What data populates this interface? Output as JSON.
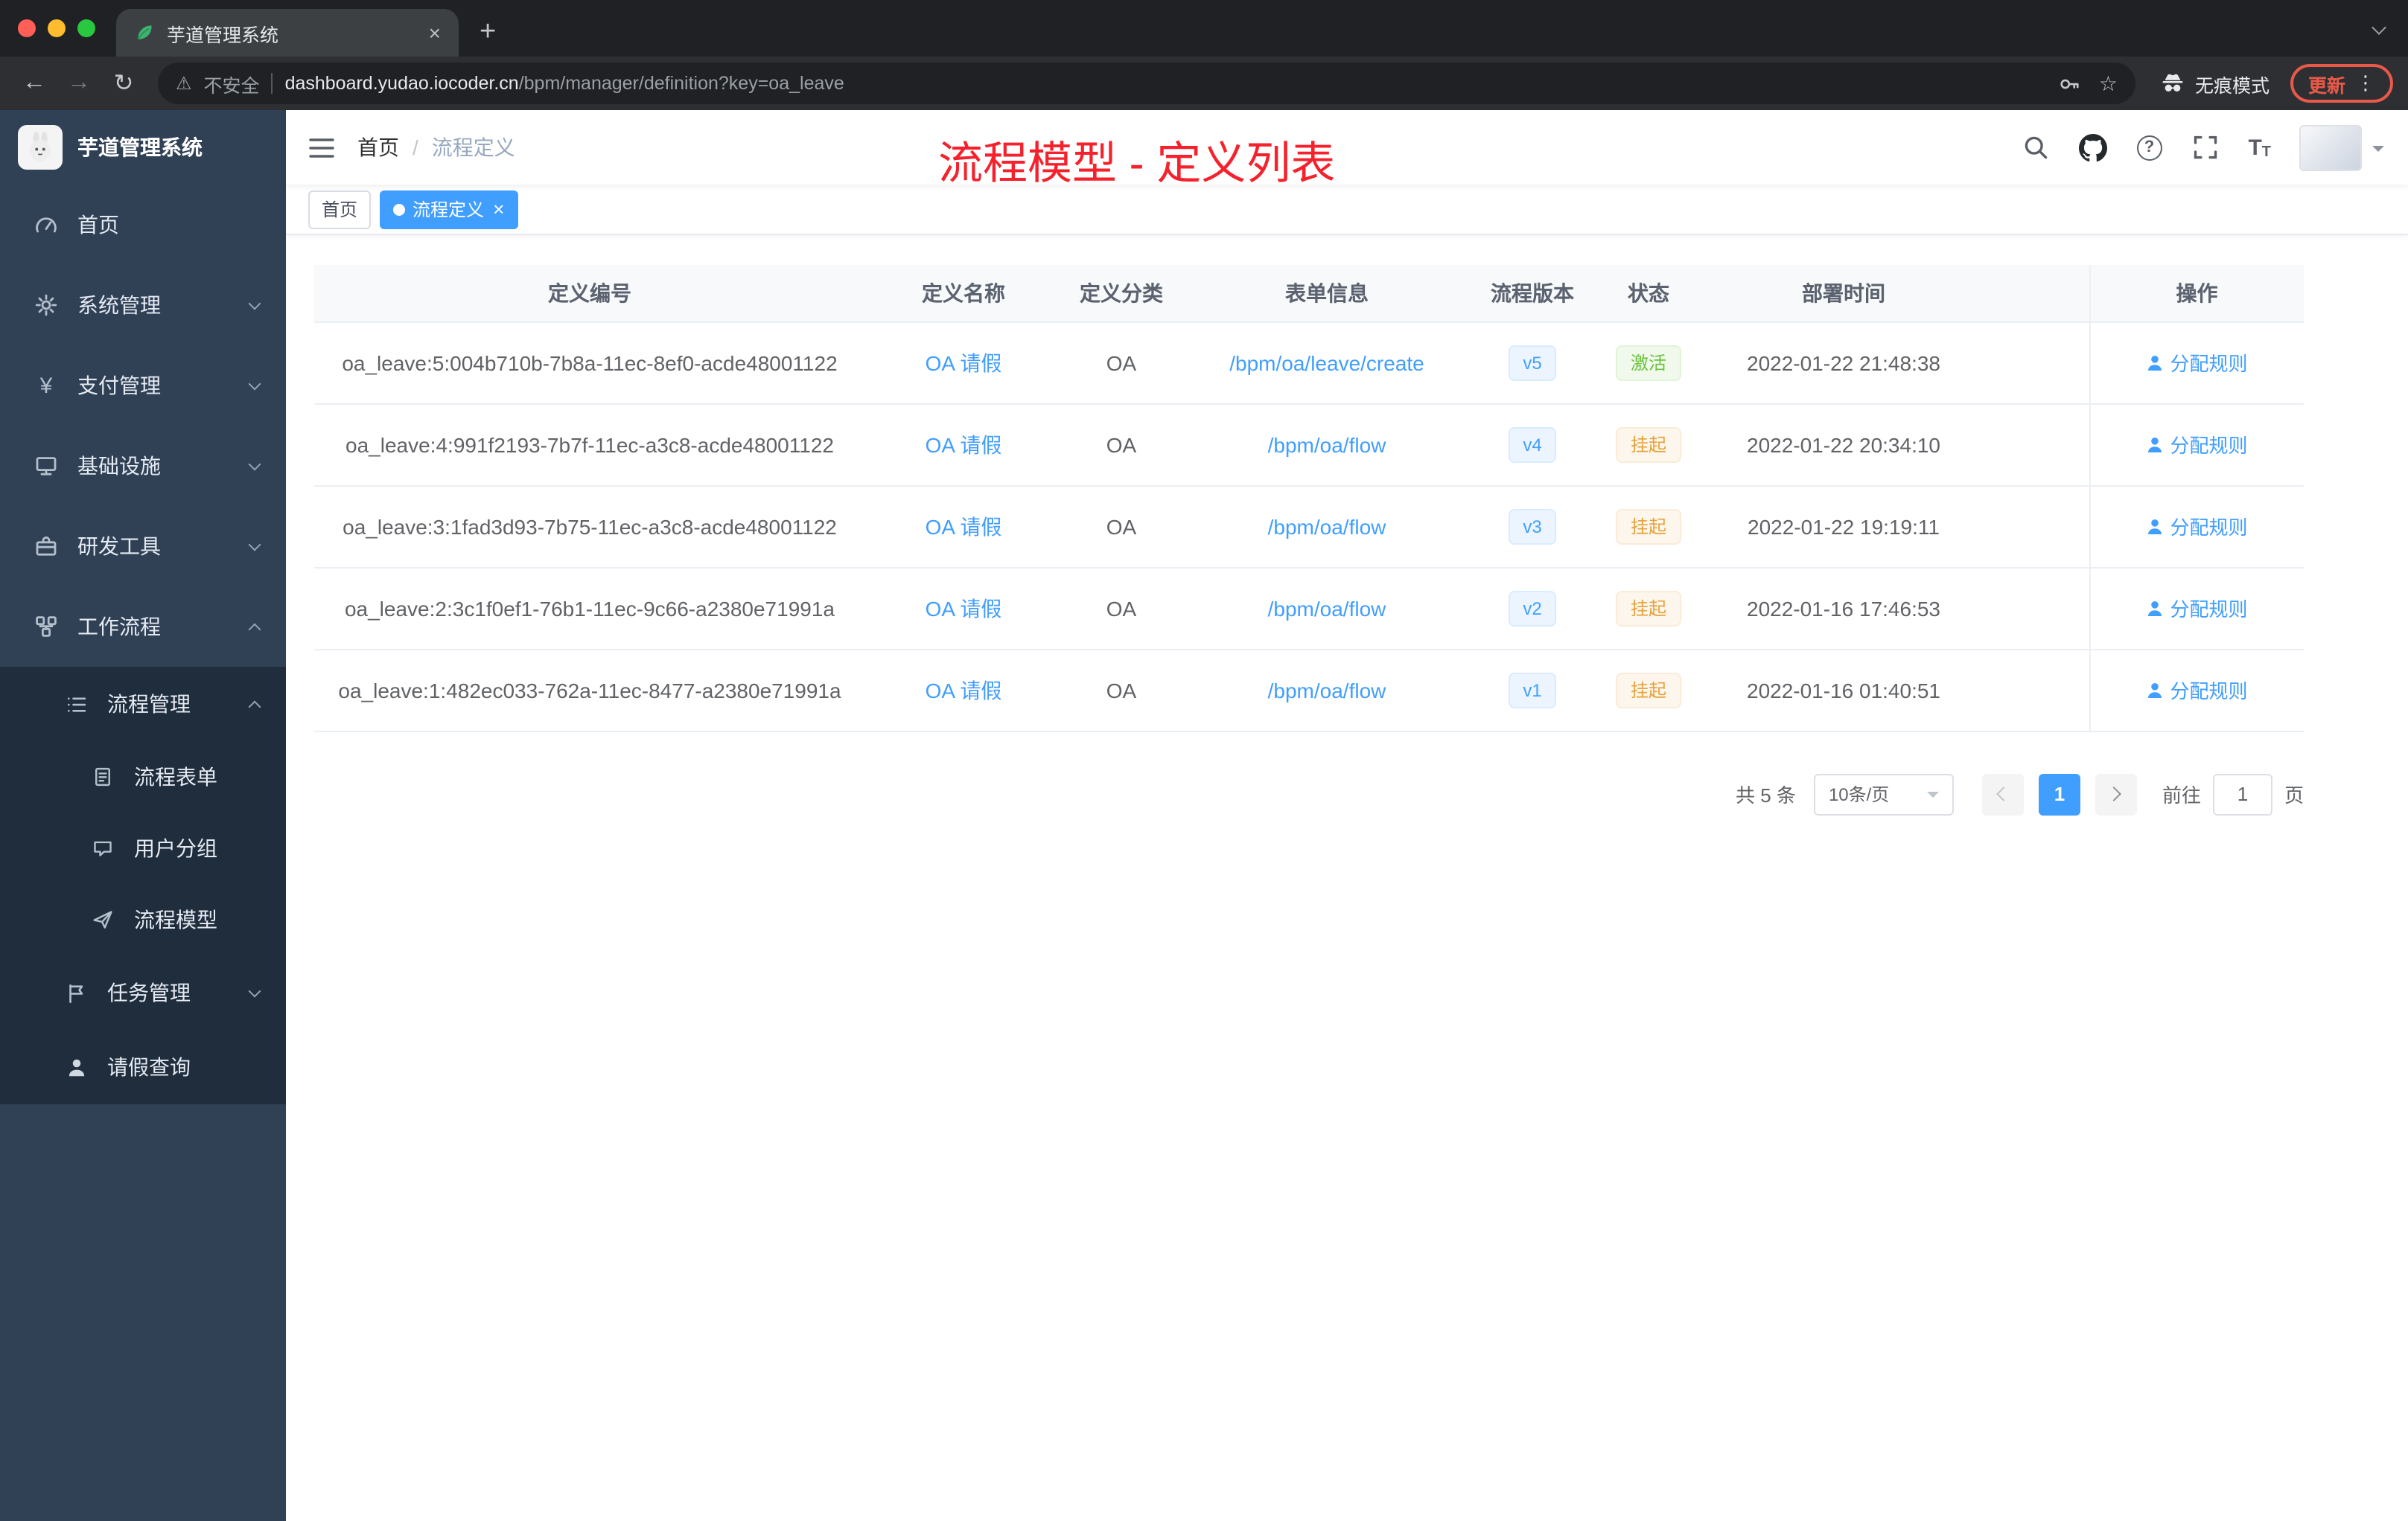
{
  "icons": {
    "back": "←",
    "forward": "→",
    "reload": "↻",
    "warning": "⚠",
    "star": "☆",
    "menu_dots": "⋮",
    "new_tab": "+",
    "close": "×",
    "yen": "¥",
    "help": "?"
  },
  "browser": {
    "tab_title": "芋道管理系统",
    "security_label": "不安全",
    "url_domain": "dashboard.yudao.iocoder.cn",
    "url_path": "/bpm/manager/definition?key=oa_leave",
    "incognito_label": "无痕模式",
    "update_label": "更新"
  },
  "sidebar": {
    "logo_title": "芋道管理系统",
    "items": [
      {
        "label": "首页"
      },
      {
        "label": "系统管理"
      },
      {
        "label": "支付管理"
      },
      {
        "label": "基础设施"
      },
      {
        "label": "研发工具"
      },
      {
        "label": "工作流程"
      },
      {
        "label": "流程管理"
      },
      {
        "label": "流程表单"
      },
      {
        "label": "用户分组"
      },
      {
        "label": "流程模型"
      },
      {
        "label": "任务管理"
      },
      {
        "label": "请假查询"
      }
    ]
  },
  "navbar": {
    "breadcrumb_home": "首页",
    "breadcrumb_current": "流程定义",
    "annotation": "流程模型 - 定义列表"
  },
  "tags": {
    "home": "首页",
    "active": "流程定义"
  },
  "table": {
    "headers": [
      "定义编号",
      "定义名称",
      "定义分类",
      "表单信息",
      "流程版本",
      "状态",
      "部署时间",
      "操作"
    ],
    "rows": [
      {
        "id": "oa_leave:5:004b710b-7b8a-11ec-8ef0-acde48001122",
        "name": "OA 请假",
        "category": "OA",
        "form": "/bpm/oa/leave/create",
        "version": "v5",
        "status": "激活",
        "time": "2022-01-22 21:48:38",
        "action": "分配规则"
      },
      {
        "id": "oa_leave:4:991f2193-7b7f-11ec-a3c8-acde48001122",
        "name": "OA 请假",
        "category": "OA",
        "form": "/bpm/oa/flow",
        "version": "v4",
        "status": "挂起",
        "time": "2022-01-22 20:34:10",
        "action": "分配规则"
      },
      {
        "id": "oa_leave:3:1fad3d93-7b75-11ec-a3c8-acde48001122",
        "name": "OA 请假",
        "category": "OA",
        "form": "/bpm/oa/flow",
        "version": "v3",
        "status": "挂起",
        "time": "2022-01-22 19:19:11",
        "action": "分配规则"
      },
      {
        "id": "oa_leave:2:3c1f0ef1-76b1-11ec-9c66-a2380e71991a",
        "name": "OA 请假",
        "category": "OA",
        "form": "/bpm/oa/flow",
        "version": "v2",
        "status": "挂起",
        "time": "2022-01-16 17:46:53",
        "action": "分配规则"
      },
      {
        "id": "oa_leave:1:482ec033-762a-11ec-8477-a2380e71991a",
        "name": "OA 请假",
        "category": "OA",
        "form": "/bpm/oa/flow",
        "version": "v1",
        "status": "挂起",
        "time": "2022-01-16 01:40:51",
        "action": "分配规则"
      }
    ]
  },
  "pagination": {
    "total": "共 5 条",
    "page_size": "10条/页",
    "page": "1",
    "goto_label": "前往",
    "goto_value": "1",
    "page_unit": "页"
  }
}
